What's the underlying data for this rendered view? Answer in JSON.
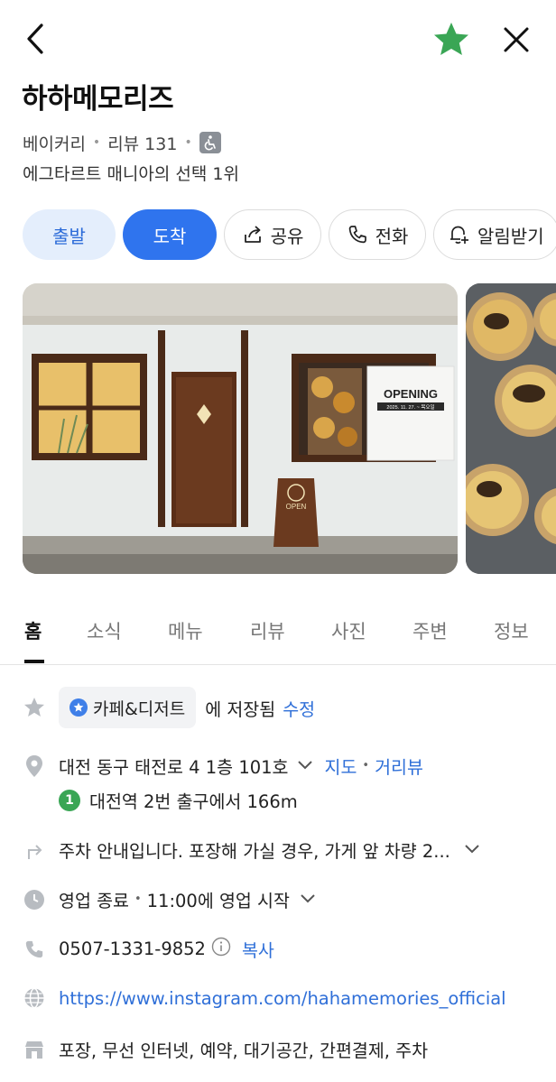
{
  "header": {
    "back_icon": "chevron-left-icon",
    "favorite_icon": "star-filled-icon",
    "close_icon": "close-icon",
    "favorite_color": "#3aa655"
  },
  "place": {
    "name": "하하메모리즈",
    "category": "베이커리",
    "review_label": "리뷰 131",
    "accessibility_icon": "wheelchair-icon",
    "tagline": "에그타르트 매니아의 선택 1위"
  },
  "actions": {
    "depart": "출발",
    "arrive": "도착",
    "share": "공유",
    "call": "전화",
    "notify": "알림받기"
  },
  "photos": {
    "main_sign": "OPENING",
    "main_sign_sub": "2025. 11. 27. ~ 목오일",
    "board_text": "OPEN"
  },
  "tabs": [
    "홈",
    "소식",
    "메뉴",
    "리뷰",
    "사진",
    "주변",
    "정보"
  ],
  "info": {
    "saved": {
      "chip_label": "카페&디저트",
      "text": "에 저장됨",
      "edit_link": "수정"
    },
    "address": {
      "text": "대전 동구 태전로 4 1층 101호",
      "map_link": "지도",
      "street_link": "거리뷰",
      "station_number": "1",
      "station_text": "대전역 2번 출구에서 166m"
    },
    "parking": "주차 안내입니다. 포장해 가실 경우, 가게 앞 차량 2...",
    "hours": {
      "status": "영업 종료",
      "next": "11:00에 영업 시작"
    },
    "phone": {
      "number": "0507-1331-9852",
      "copy_link": "복사"
    },
    "website": "https://www.instagram.com/hahamemories_official",
    "amenities": "포장, 무선 인터넷, 예약, 대기공간, 간편결제, 주차"
  },
  "colors": {
    "primary_blue": "#2f74ee",
    "link_blue": "#2f6fd8",
    "light_blue": "#e4eefc",
    "icon_grey": "#9aa0a6"
  }
}
